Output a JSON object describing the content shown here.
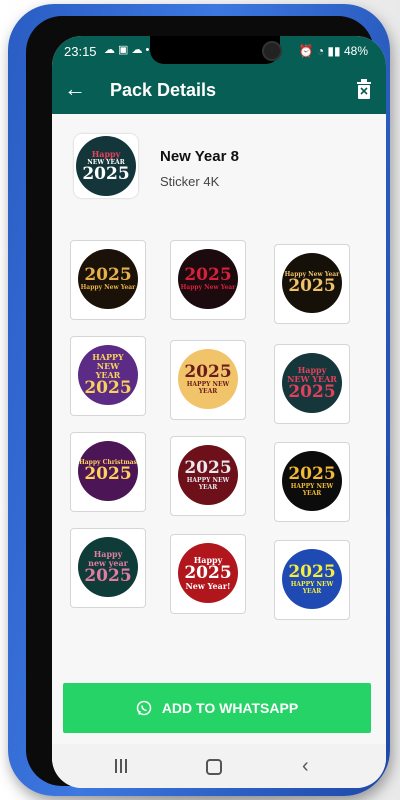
{
  "status_bar": {
    "time": "23:15",
    "left_icons": "☁ ▣ ☁ •",
    "right_icons": "⏰ ◔ ▮▮ ",
    "battery": "48%"
  },
  "app_bar": {
    "title": "Pack Details"
  },
  "pack": {
    "name": "New Year 8",
    "publisher": "Sticker 4K",
    "icon_text": [
      "Happy",
      "NEW YEAR",
      "2025"
    ]
  },
  "stickers": [
    {
      "lines": [
        "2025",
        "Happy New Year"
      ],
      "colors": {
        "bg": "#1a1208",
        "fg": "#e8b04a"
      }
    },
    {
      "lines": [
        "2025",
        "Happy New Year"
      ],
      "colors": {
        "bg": "#1b0a0e",
        "fg": "#d8203a"
      }
    },
    {
      "lines": [
        "Happy New Year",
        "2025"
      ],
      "colors": {
        "bg": "#151008",
        "fg": "#f0c26a"
      }
    },
    {
      "lines": [
        "HAPPY",
        "NEW",
        "YEAR",
        "2025"
      ],
      "colors": {
        "bg": "#5c2b86",
        "fg": "#f7d35a"
      }
    },
    {
      "lines": [
        "2025",
        "HAPPY NEW YEAR"
      ],
      "colors": {
        "bg": "#f1c46a",
        "fg": "#6b1b1b"
      }
    },
    {
      "lines": [
        "Happy",
        "NEW YEAR",
        "2025"
      ],
      "colors": {
        "bg": "#15363a",
        "fg": "#e3415b"
      }
    },
    {
      "lines": [
        "Happy Christmas",
        "2025"
      ],
      "colors": {
        "bg": "#4b1556",
        "fg": "#ffd15c"
      }
    },
    {
      "lines": [
        "2025",
        "HAPPY NEW YEAR"
      ],
      "colors": {
        "bg": "#6d1019",
        "fg": "#e8e8ee"
      }
    },
    {
      "lines": [
        "2025",
        "HAPPY NEW YEAR"
      ],
      "colors": {
        "bg": "#0c0c0c",
        "fg": "#f2b935"
      }
    },
    {
      "lines": [
        "Happy",
        "new year",
        "2025"
      ],
      "colors": {
        "bg": "#0f3b38",
        "fg": "#e27ca0"
      }
    },
    {
      "lines": [
        "Happy",
        "2025",
        "New Year!"
      ],
      "colors": {
        "bg": "#b1161c",
        "fg": "#ffffff"
      }
    },
    {
      "lines": [
        "2025",
        "HAPPY NEW YEAR"
      ],
      "colors": {
        "bg": "#1f49b3",
        "fg": "#f6ee3c"
      }
    }
  ],
  "actions": {
    "add_to_whatsapp": "ADD TO WHATSAPP"
  },
  "colors": {
    "primary": "#075e54",
    "accent": "#25d366",
    "phone_frame": "#2a5dc4"
  }
}
